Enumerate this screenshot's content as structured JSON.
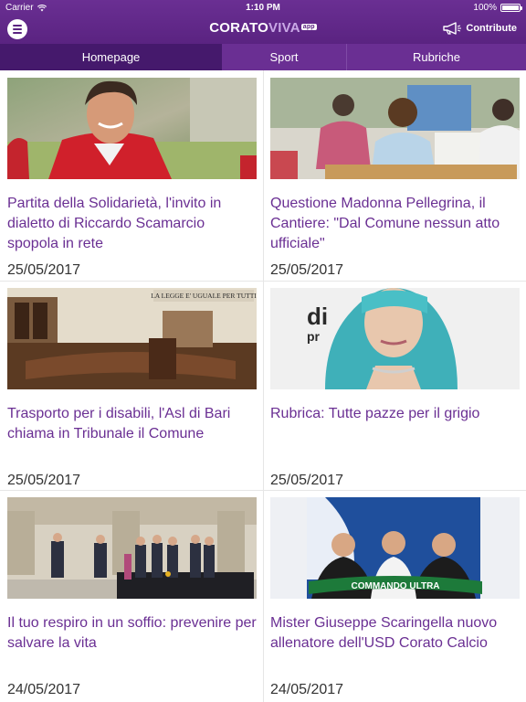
{
  "status": {
    "carrier": "Carrier",
    "time": "1:10 PM",
    "battery": "100%"
  },
  "app": {
    "logo_part1": "CORATO",
    "logo_part2": "VIVA",
    "logo_badge": "app",
    "contribute_label": "Contribute"
  },
  "tabs": [
    {
      "label": "Homepage",
      "active": true
    },
    {
      "label": "Sport",
      "active": false
    },
    {
      "label": "Rubriche",
      "active": false
    }
  ],
  "articles": [
    {
      "title": "Partita della Solidarietà, l'invito in dialetto di Riccardo Scamarcio spopola in rete",
      "date": "25/05/2017"
    },
    {
      "title": "Questione Madonna Pellegrina, il Cantiere: \"Dal Comune nessun atto ufficiale\"",
      "date": "25/05/2017"
    },
    {
      "title": "Trasporto per i disabili, l'Asl di Bari chiama in Tribunale il Comune",
      "date": "25/05/2017"
    },
    {
      "title": "Rubrica: Tutte pazze per il grigio",
      "date": "25/05/2017"
    },
    {
      "title": "Il tuo respiro in un soffio: prevenire per salvare la vita",
      "date": "24/05/2017"
    },
    {
      "title": "Mister Giuseppe Scaringella nuovo allenatore dell'USD Corato Calcio",
      "date": "24/05/2017"
    }
  ],
  "image_text": {
    "courtroom_sign": "LA LEGGE E' UGUALE PER TUTTI",
    "banner_text": "COMMANDO ULTRA"
  },
  "colors": {
    "brand": "#6a2f93",
    "tab_active": "#45196c",
    "title_text": "#6a2f93"
  }
}
